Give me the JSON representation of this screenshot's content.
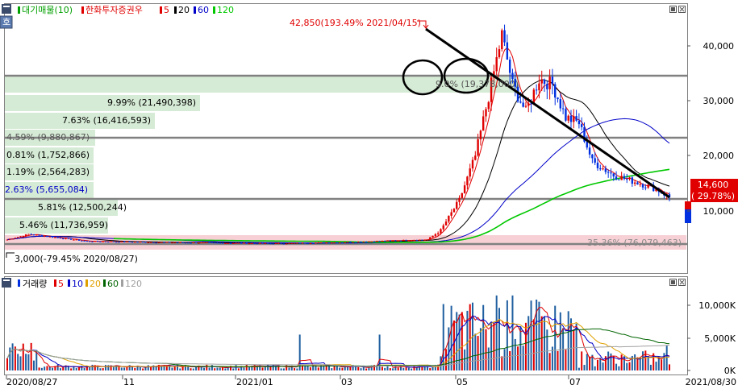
{
  "price_panel": {
    "legend": {
      "market_label": "대기매물(10)",
      "stock_label": "한화투자증권우",
      "ma_labels": [
        "5",
        "20",
        "60",
        "120"
      ],
      "ma_colors": [
        "#e00000",
        "#000000",
        "#0000c8",
        "#00c800"
      ]
    },
    "high_annotation": "42,850(193.49% 2021/04/15)",
    "low_annotation": "3,000(-79.45% 2020/08/27)",
    "current_price": "14,600",
    "current_change": "( 29.78%)",
    "volume_profile": [
      {
        "text": "",
        "dim": false
      },
      {
        "text": "9.99% (21,490,398)",
        "dim": false
      },
      {
        "text": "7.63% (16,416,593)",
        "dim": false
      },
      {
        "text": "4.59% (9,880,867)",
        "dim": true
      },
      {
        "text": "0.81% (1,752,866)",
        "dim": false
      },
      {
        "text": "1.19% (2,564,283)",
        "dim": false
      },
      {
        "text": "2.63% (5,655,084)",
        "dim": false
      },
      {
        "text": "5.81% (12,500,244)",
        "dim": false
      },
      {
        "text": "5.46% (11,736,959)",
        "dim": false
      },
      {
        "text": "35.36% (76,079,463)",
        "dim": true
      }
    ],
    "overlay_text": "9.0% (19,378,000)",
    "y_ticks": [
      "40,000",
      "30,000",
      "20,000",
      "10,000"
    ]
  },
  "volume_panel": {
    "legend": {
      "title": "거래량",
      "ma_labels": [
        "5",
        "10",
        "20",
        "60",
        "120"
      ],
      "ma_colors": [
        "#e00000",
        "#0000c8",
        "#e0a000",
        "#006400",
        "#a0a0a0"
      ]
    },
    "y_ticks": [
      "10,000K",
      "5,000K",
      "0K"
    ]
  },
  "x_axis": {
    "labels": [
      "2020/08/27",
      "11",
      "2021/01",
      "03",
      "05",
      "07",
      "2021/08/30"
    ]
  },
  "colors": {
    "up": "#e00000",
    "down": "#0030e0",
    "zone_green": "#cfe8cf",
    "zone_pink": "#f4c8cc",
    "hline": "#808080"
  }
}
